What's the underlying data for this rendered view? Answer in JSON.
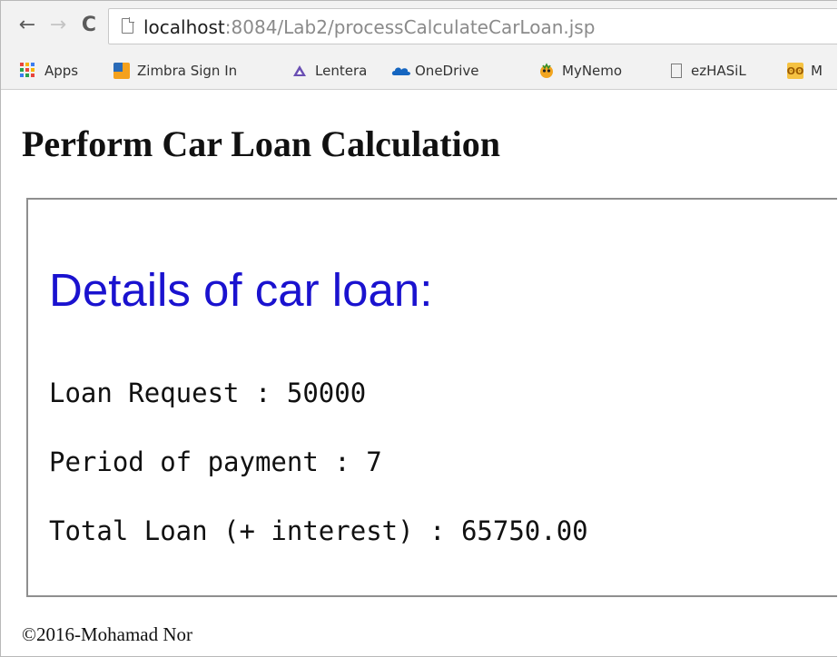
{
  "browser": {
    "back_glyph": "←",
    "forward_glyph": "→",
    "reload_glyph": "C",
    "url_host": "localhost",
    "url_rest": ":8084/Lab2/processCalculateCarLoan.jsp",
    "page_icon": "page-icon"
  },
  "bookmarks": [
    {
      "label": "Apps",
      "icon": "apps-grid-icon"
    },
    {
      "label": "Zimbra Sign In",
      "icon": "zimbra-icon"
    },
    {
      "label": "Lentera",
      "icon": "lentera-icon"
    },
    {
      "label": "OneDrive",
      "icon": "onedrive-icon"
    },
    {
      "label": "MyNemo",
      "icon": "mynemo-icon"
    },
    {
      "label": "ezHASiL",
      "icon": "document-icon"
    },
    {
      "label": "M",
      "icon": "mm-icon"
    }
  ],
  "page": {
    "heading": "Perform Car Loan Calculation",
    "details_title": "Details of car loan:",
    "details": [
      "Loan Request : 50000",
      "Period of payment : 7",
      "Total Loan (+ interest) : 65750.00"
    ],
    "footer": "©2016-Mohamad Nor"
  },
  "colors": {
    "details_title": "#1a12cf",
    "chrome_background": "#f2f2f2",
    "box_border": "#8f8f8f"
  }
}
